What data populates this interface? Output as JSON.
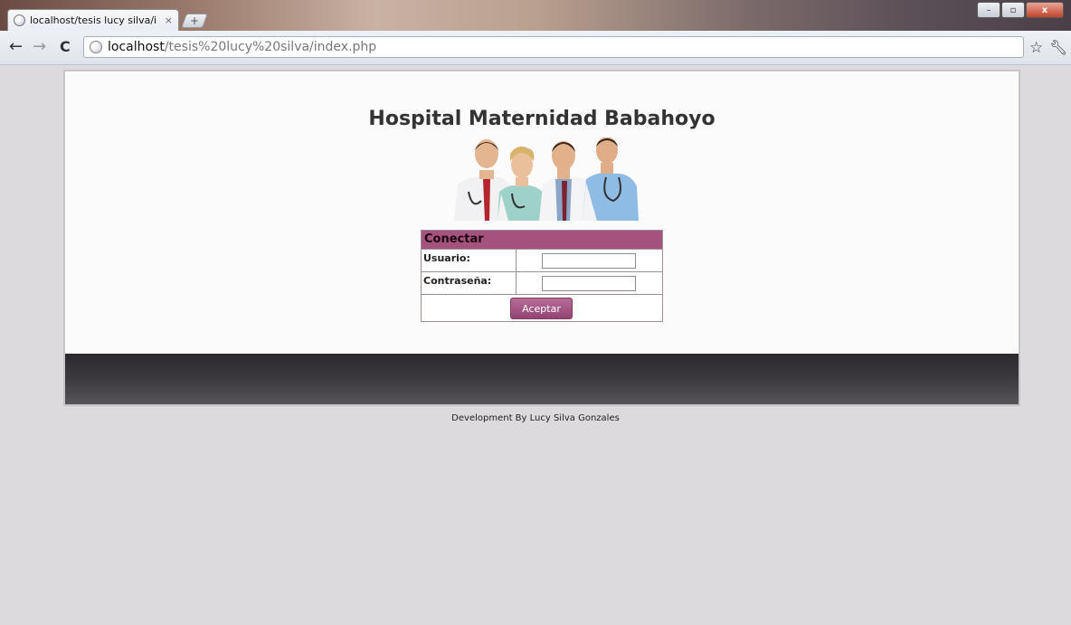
{
  "browser": {
    "tab_title": "localhost/tesis lucy silva/in",
    "tab_close": "×",
    "new_tab": "+",
    "window_buttons": {
      "minimize": "–",
      "maximize": "▫",
      "close": "x"
    },
    "nav": {
      "back": "←",
      "forward": "→",
      "reload": "C"
    },
    "url_host": "localhost",
    "url_path": "/tesis%20lucy%20silva/index.php",
    "bookmark_icon": "star-icon",
    "menu_icon": "wrench-icon"
  },
  "page": {
    "title": "Hospital Maternidad Babahoyo",
    "image": "doctors-group-illustration"
  },
  "login": {
    "header": "Conectar",
    "username_label": "Usuario:",
    "username_value": "",
    "password_label": "Contraseña:",
    "password_value": "",
    "submit_label": "Aceptar"
  },
  "footer": {
    "credit": "Development By Lucy Silva Gonzales"
  },
  "colors": {
    "page_bg": "#dcdadd",
    "accent": "#a5527e",
    "button": "#a4557f",
    "footer_band": "#3a383c"
  }
}
